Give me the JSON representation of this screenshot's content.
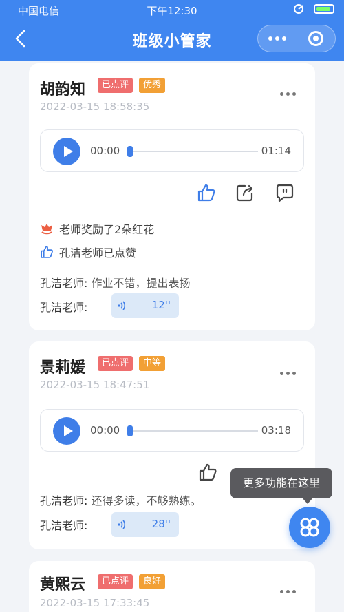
{
  "status_bar": {
    "carrier": "中国电信",
    "time": "下午12:30"
  },
  "nav": {
    "title": "班级小管家"
  },
  "tooltip": "更多功能在这里",
  "cards": [
    {
      "name": "胡韵知",
      "tags": [
        "已点评",
        "优秀"
      ],
      "datetime": "2022-03-15 18:58:35",
      "current_time": "00:00",
      "duration": "01:14",
      "reward_text": "老师奖励了2朵红花",
      "like_text": "孔洁老师已点赞",
      "comment_author": "孔洁老师:",
      "comment_text": "作业不错，提出表扬",
      "voice_author": "孔洁老师:",
      "voice_length": "12''"
    },
    {
      "name": "景莉媛",
      "tags": [
        "已点评",
        "中等"
      ],
      "datetime": "2022-03-15 18:47:51",
      "current_time": "00:00",
      "duration": "03:18",
      "comment_author": "孔洁老师:",
      "comment_text": "还得多读，不够熟练。",
      "voice_author": "孔洁老师:",
      "voice_length": "28''"
    },
    {
      "name": "黄熙云",
      "tags": [
        "已点评",
        "良好"
      ],
      "datetime": "2022-03-15 17:33:45"
    }
  ],
  "colors": {
    "accent": "#3f86f0",
    "tag_reviewed": "#ef6e6e",
    "tag_grade": "#f2a035"
  },
  "icons": [
    "back-icon",
    "more-dots-icon",
    "close-circle-icon",
    "play-icon",
    "thumbs-up-icon",
    "share-icon",
    "comment-icon",
    "flower-icon",
    "voice-wave-icon",
    "grid-menu-icon"
  ]
}
